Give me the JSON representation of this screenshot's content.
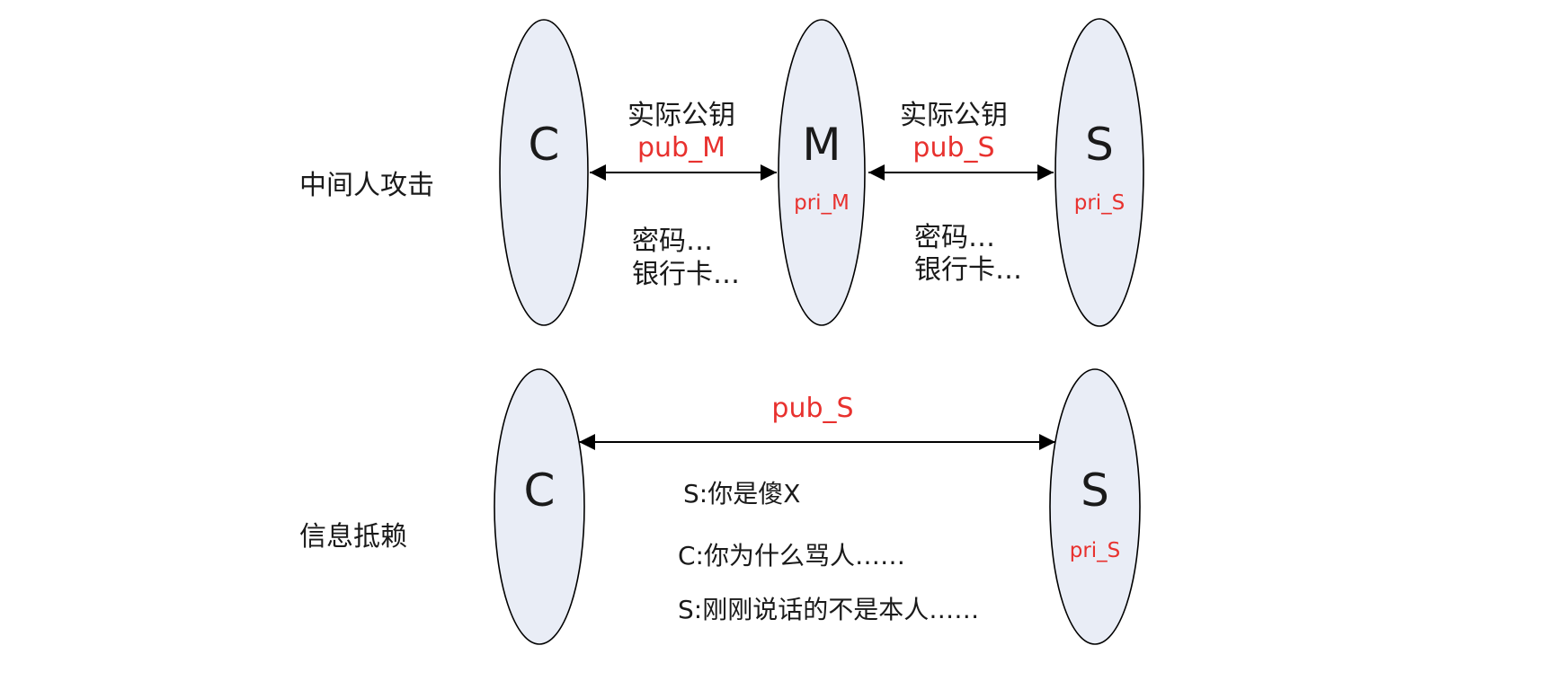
{
  "colors": {
    "node_fill": "#e9edf6",
    "outline": "#000000",
    "text": "#1a1a1a",
    "key_red": "#e8312e"
  },
  "section_mitm": {
    "label": "中间人攻击",
    "nodes": {
      "client": {
        "letter": "C"
      },
      "middle": {
        "letter": "M",
        "key": "pri_M"
      },
      "server": {
        "letter": "S",
        "key": "pri_S"
      }
    },
    "link_left": {
      "caption": "实际公钥",
      "key": "pub_M",
      "notes": [
        "密码…",
        "银行卡…"
      ]
    },
    "link_right": {
      "caption": "实际公钥",
      "key": "pub_S",
      "notes": [
        "密码…",
        "银行卡…"
      ]
    }
  },
  "section_repudiation": {
    "label": "信息抵赖",
    "nodes": {
      "client": {
        "letter": "C"
      },
      "server": {
        "letter": "S",
        "key": "pri_S"
      }
    },
    "link": {
      "key": "pub_S"
    },
    "messages": [
      "S:你是傻X",
      "C:你为什么骂人……",
      "S:刚刚说话的不是本人……"
    ]
  }
}
